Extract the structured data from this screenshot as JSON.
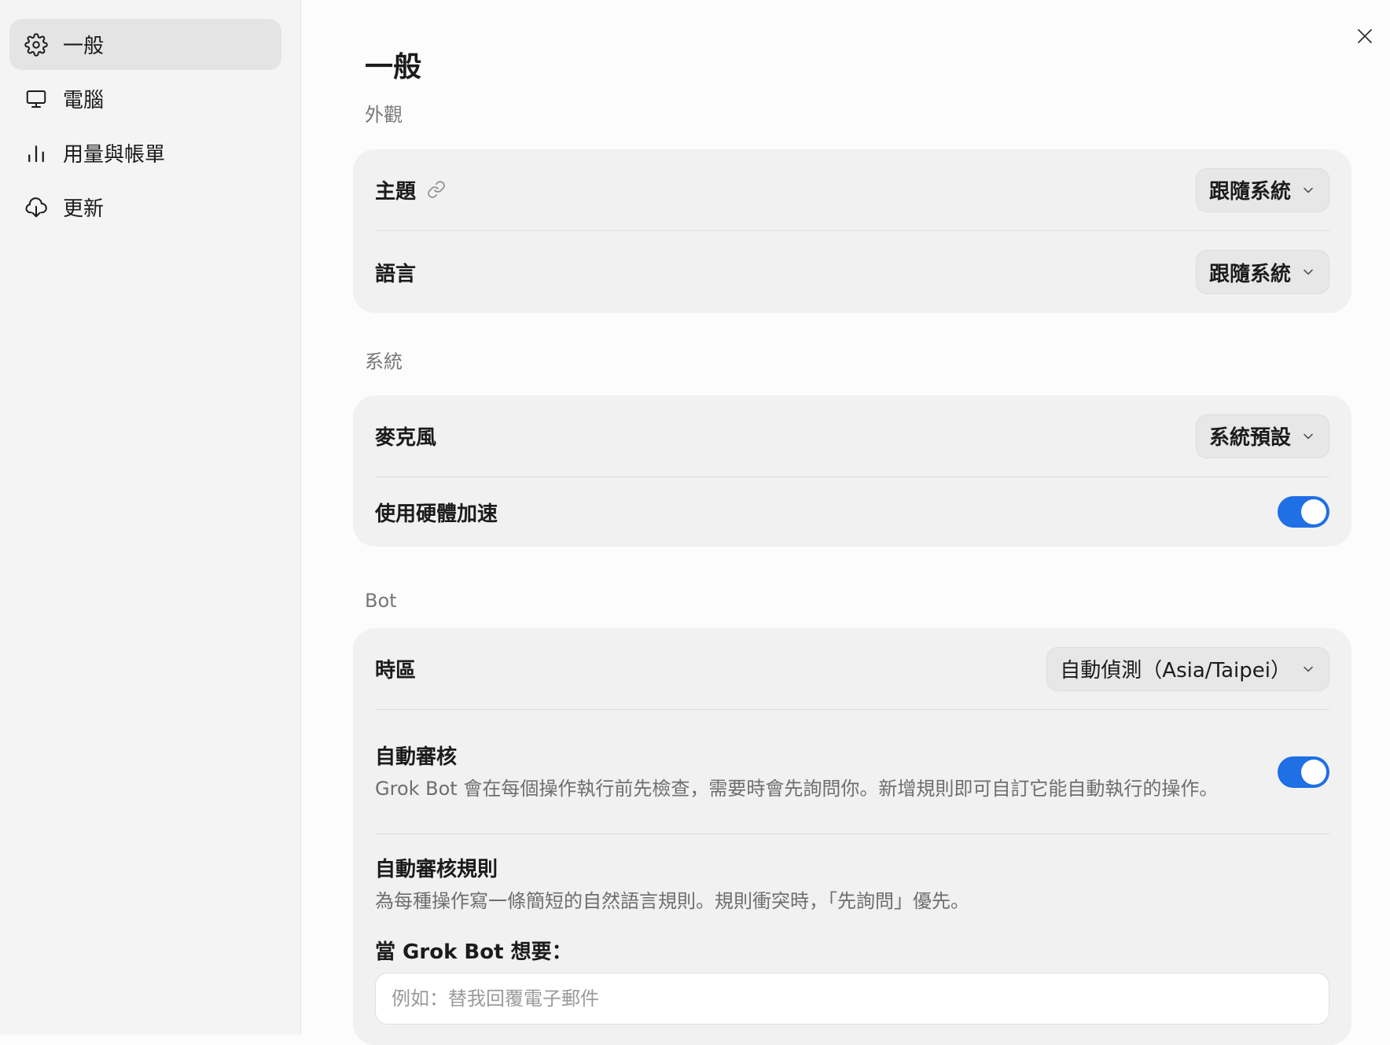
{
  "sidebar": {
    "items": [
      {
        "label": "一般",
        "icon": "gear-icon",
        "active": true
      },
      {
        "label": "電腦",
        "icon": "monitor-icon"
      },
      {
        "label": "用量與帳單",
        "icon": "bar-chart-icon"
      },
      {
        "label": "更新",
        "icon": "cloud-download-icon"
      }
    ]
  },
  "page": {
    "title": "一般"
  },
  "appearance": {
    "section_label": "外觀",
    "theme_label": "主題",
    "theme_value": "跟隨系統",
    "language_label": "語言",
    "language_value": "跟隨系統"
  },
  "system": {
    "section_label": "系統",
    "microphone_label": "麥克風",
    "microphone_value": "系統預設",
    "hw_accel_label": "使用硬體加速",
    "hw_accel_on": true
  },
  "bot": {
    "section_label": "Bot",
    "timezone_label": "時區",
    "timezone_value": "自動偵測（Asia/Taipei）",
    "auto_review_label": "自動審核",
    "auto_review_desc": "Grok Bot 會在每個操作執行前先檢查，需要時會先詢問你。新增規則即可自訂它能自動執行的操作。",
    "auto_review_on": true,
    "rules_label": "自動審核規則",
    "rules_desc": "為每種操作寫一條簡短的自然語言規則。規則衝突時，「先詢問」優先。",
    "when_label": "當 Grok Bot 想要：",
    "when_placeholder": "例如：替我回覆電子郵件",
    "when_value": ""
  },
  "colors": {
    "accent": "#1f6fe5",
    "sidebar_bg": "#f4f4f4",
    "card_bg": "#f1f1f1"
  }
}
